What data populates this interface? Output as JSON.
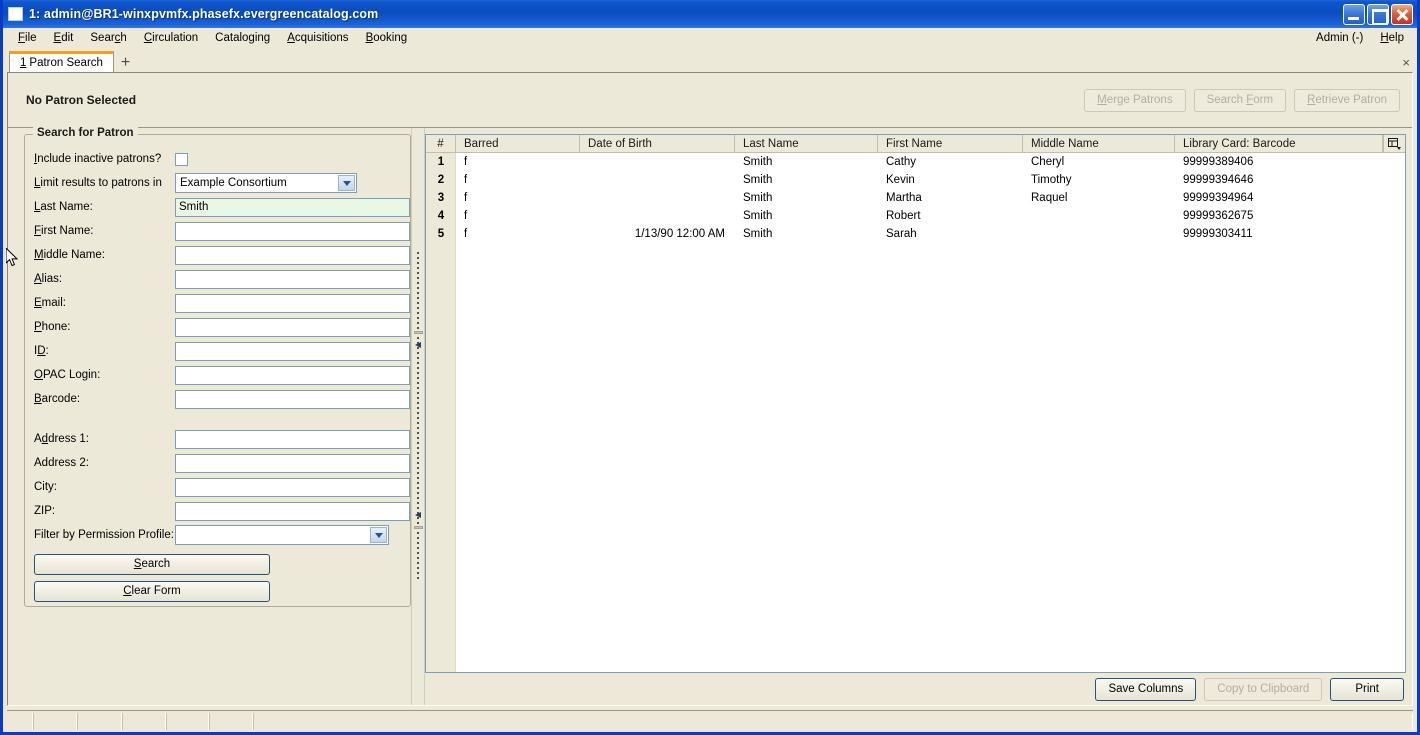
{
  "window": {
    "title": "1: admin@BR1-winxpvmfx.phasefx.evergreencatalog.com",
    "icon": "window-icon",
    "minimize_label": "",
    "maximize_label": "",
    "close_label": ""
  },
  "menubar": {
    "items": [
      {
        "label": "File",
        "accesskey": "F"
      },
      {
        "label": "Edit",
        "accesskey": "E"
      },
      {
        "label": "Search",
        "accesskey": "c"
      },
      {
        "label": "Circulation",
        "accesskey": "C"
      },
      {
        "label": "Cataloging",
        "accesskey": "g"
      },
      {
        "label": "Acquisitions",
        "accesskey": "A"
      },
      {
        "label": "Booking",
        "accesskey": "B"
      }
    ],
    "right_items": [
      {
        "label": "Admin (-)",
        "accesskey": ""
      },
      {
        "label": "Help",
        "accesskey": "H"
      }
    ]
  },
  "tabs": {
    "active": {
      "number": "1",
      "label": "Patron Search"
    },
    "new_tab_label": "+",
    "close_label": "×"
  },
  "patron_header": {
    "status": "No Patron Selected",
    "buttons": [
      {
        "label": "Merge Patrons",
        "name": "merge-patrons-button",
        "enabled": false
      },
      {
        "label": "Search Form",
        "name": "search-form-button",
        "enabled": false
      },
      {
        "label": "Retrieve Patron",
        "name": "retrieve-patron-button",
        "enabled": false
      }
    ]
  },
  "search_form": {
    "legend": "Search for Patron",
    "include_inactive_label": "Include inactive patrons?",
    "include_inactive_checked": false,
    "limit_results_label": "Limit results to patrons in",
    "limit_results_value": "Example Consortium",
    "fields": [
      {
        "label": "Last Name:",
        "value": "Smith",
        "name": "last-name-field",
        "active": true
      },
      {
        "label": "First Name:",
        "value": "",
        "name": "first-name-field",
        "active": false
      },
      {
        "label": "Middle Name:",
        "value": "",
        "name": "middle-name-field",
        "active": false
      },
      {
        "label": "Alias:",
        "value": "",
        "name": "alias-field",
        "active": false
      },
      {
        "label": "Email:",
        "value": "",
        "name": "email-field",
        "active": false
      },
      {
        "label": "Phone:",
        "value": "",
        "name": "phone-field",
        "active": false
      },
      {
        "label": "ID:",
        "value": "",
        "name": "id-field",
        "active": false
      },
      {
        "label": "OPAC Login:",
        "value": "",
        "name": "opac-login-field",
        "active": false
      },
      {
        "label": "Barcode:",
        "value": "",
        "name": "barcode-field",
        "active": false
      }
    ],
    "address_fields": [
      {
        "label": "Address 1:",
        "value": "",
        "name": "address-1-field"
      },
      {
        "label": "Address 2:",
        "value": "",
        "name": "address-2-field"
      },
      {
        "label": "City:",
        "value": "",
        "name": "city-field"
      },
      {
        "label": "ZIP:",
        "value": "",
        "name": "zip-field"
      }
    ],
    "permission_profile_label": "Filter by Permission Profile:",
    "permission_profile_value": "",
    "search_button": "Search",
    "clear_button": "Clear Form"
  },
  "results": {
    "columns": [
      "#",
      "Barred",
      "Date of Birth",
      "Last Name",
      "First Name",
      "Middle Name",
      "Library Card: Barcode"
    ],
    "column_picker_icon": "column-picker-icon",
    "rows": [
      {
        "num": "1",
        "barred": "f",
        "dob": "",
        "last": "Smith",
        "first": "Cathy",
        "middle": "Cheryl",
        "card": "99999389406"
      },
      {
        "num": "2",
        "barred": "f",
        "dob": "",
        "last": "Smith",
        "first": "Kevin",
        "middle": "Timothy",
        "card": "99999394646"
      },
      {
        "num": "3",
        "barred": "f",
        "dob": "",
        "last": "Smith",
        "first": "Martha",
        "middle": "Raquel",
        "card": "99999394964"
      },
      {
        "num": "4",
        "barred": "f",
        "dob": "",
        "last": "Smith",
        "first": "Robert",
        "middle": "",
        "card": "99999362675"
      },
      {
        "num": "5",
        "barred": "f",
        "dob": "1/13/90 12:00 AM",
        "last": "Smith",
        "first": "Sarah",
        "middle": "",
        "card": "99999303411"
      }
    ],
    "footer_buttons": [
      {
        "label": "Save Columns",
        "name": "save-columns-button",
        "enabled": true
      },
      {
        "label": "Copy to Clipboard",
        "name": "copy-to-clipboard-button",
        "enabled": false
      },
      {
        "label": "Print",
        "name": "print-button",
        "enabled": true
      }
    ]
  },
  "statusbar": {
    "panels": [
      "",
      "",
      "",
      "",
      "",
      "",
      ""
    ]
  },
  "colors": {
    "titlebar_blue": "#0a4cc0",
    "window_border": "#0a3bc4",
    "face": "#ece9d8",
    "tab_accent": "#f2a01e",
    "field_border": "#7f9db9",
    "active_field_bg": "#e9f8e5",
    "button_border": "#2b4f7e",
    "disabled_text": "#b3ada0"
  }
}
